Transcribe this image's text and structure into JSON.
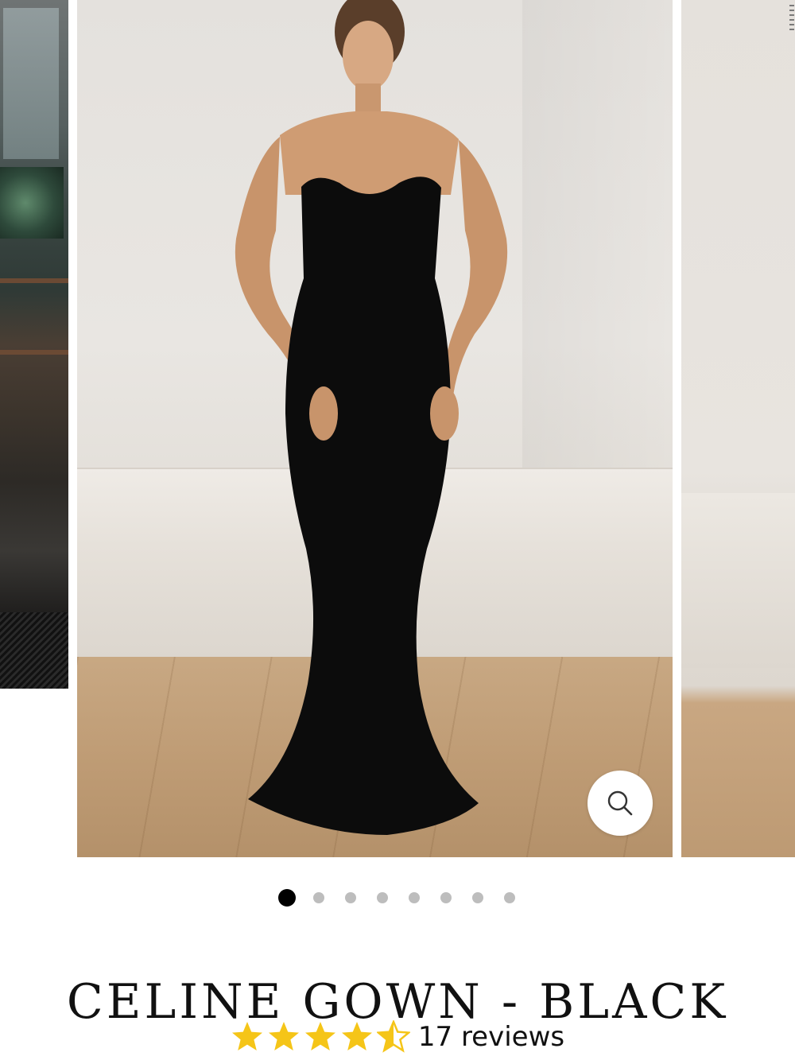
{
  "product": {
    "title": "CELINE GOWN - BLACK",
    "rating": {
      "value": 4.5,
      "max": 5,
      "reviews_label": "17 reviews"
    }
  },
  "carousel": {
    "slide_count": 8,
    "active_index": 0
  },
  "icons": {
    "zoom": "magnifier-icon",
    "star_full": "star-icon",
    "star_half": "star-half-icon"
  },
  "colors": {
    "star": "#f5c518",
    "dot_active": "#000000",
    "dot_inactive": "#bdbdbd",
    "text": "#111111"
  }
}
